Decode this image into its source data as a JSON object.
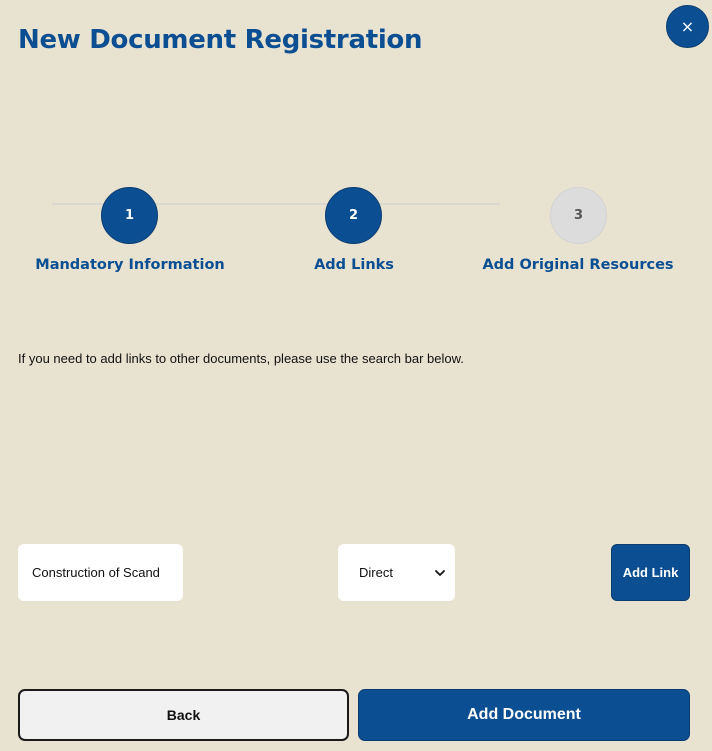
{
  "header": {
    "title": "New Document Registration",
    "close_label": "×"
  },
  "stepper": {
    "steps": [
      {
        "number": "1",
        "label": "Mandatory Information",
        "state": "active"
      },
      {
        "number": "2",
        "label": "Add Links",
        "state": "active"
      },
      {
        "number": "3",
        "label": "Add Original Resources",
        "state": "inactive"
      }
    ]
  },
  "instructions": {
    "text": "If you need to add links to other documents, please use the search bar below."
  },
  "link_form": {
    "search_value": "Construction of Scand",
    "type_selected": "Direct",
    "add_link_label": "Add Link"
  },
  "footer": {
    "back_label": "Back",
    "add_document_label": "Add Document"
  },
  "colors": {
    "background": "#e8e2d1",
    "primary": "#0b4f92",
    "inactive_step": "#dcdcdc"
  }
}
